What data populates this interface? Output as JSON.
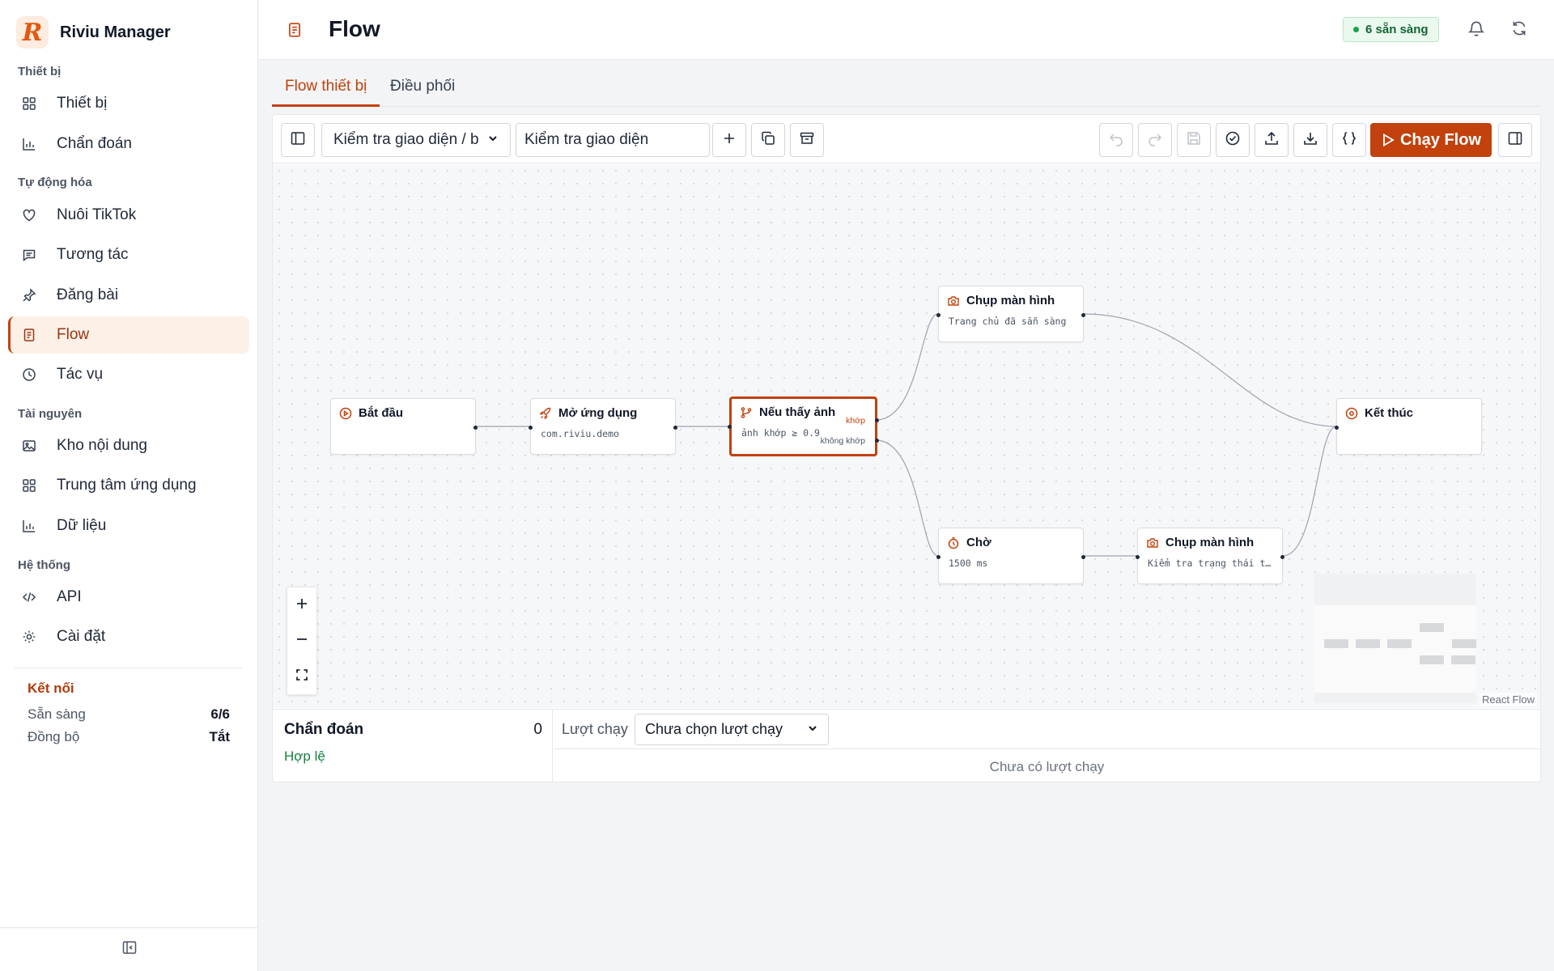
{
  "brand": {
    "logo_letter": "R",
    "name": "Riviu Manager"
  },
  "sidebar": {
    "sections": [
      {
        "label": "Thiết bị"
      },
      {
        "label": "Tự động hóa"
      },
      {
        "label": "Tài nguyên"
      },
      {
        "label": "Hệ thống"
      }
    ],
    "items": [
      {
        "label": "Thiết bị",
        "icon": "grid-icon"
      },
      {
        "label": "Chẩn đoán",
        "icon": "bar-chart-icon"
      },
      {
        "label": "Nuôi TikTok",
        "icon": "heart-icon"
      },
      {
        "label": "Tương tác",
        "icon": "message-icon"
      },
      {
        "label": "Đăng bài",
        "icon": "pin-icon"
      },
      {
        "label": "Flow",
        "icon": "document-icon",
        "active": true
      },
      {
        "label": "Tác vụ",
        "icon": "clock-icon"
      },
      {
        "label": "Kho nội dung",
        "icon": "image-icon"
      },
      {
        "label": "Trung tâm ứng dụng",
        "icon": "apps-grid-icon"
      },
      {
        "label": "Dữ liệu",
        "icon": "bar-chart-icon"
      },
      {
        "label": "API",
        "icon": "code-icon"
      },
      {
        "label": "Cài đặt",
        "icon": "sun-gear-icon"
      }
    ],
    "connection": {
      "title": "Kết nối",
      "rows": [
        {
          "key": "Sẵn sàng",
          "value": "6/6"
        },
        {
          "key": "Đồng bộ",
          "value": "Tắt"
        }
      ]
    }
  },
  "header": {
    "title": "Flow",
    "ready_badge": "6 sẵn sàng"
  },
  "tabs": [
    {
      "label": "Flow thiết bị",
      "active": true
    },
    {
      "label": "Điều phối",
      "active": false
    }
  ],
  "toolbar": {
    "flow_select": "Kiểm tra giao diện / b",
    "flow_name": "Kiểm tra giao diện",
    "run_label": "Chạy Flow"
  },
  "nodes": {
    "start": {
      "title": "Bắt đầu",
      "sub": ""
    },
    "open_app": {
      "title": "Mở ứng dụng",
      "sub": "com.riviu.demo"
    },
    "if_image": {
      "title": "Nếu thấy ảnh",
      "sub": "ảnh khớp ≥ 0.9",
      "branch_true": "khớp",
      "branch_false": "không khớp"
    },
    "screenshot_1": {
      "title": "Chụp màn hình",
      "sub": "Trang chủ đã sẵn sàng"
    },
    "end": {
      "title": "Kết thúc",
      "sub": ""
    },
    "wait": {
      "title": "Chờ",
      "sub": "1500 ms"
    },
    "screenshot_2": {
      "title": "Chụp màn hình",
      "sub": "Kiểm tra trạng thái t…"
    }
  },
  "canvas": {
    "attribution": "React Flow"
  },
  "diagnostics": {
    "title": "Chẩn đoán",
    "count": "0",
    "status": "Hợp lệ"
  },
  "runs": {
    "label": "Lượt chạy",
    "select": "Chưa chọn lượt chạy",
    "empty": "Chưa có lượt chạy"
  },
  "colors": {
    "accent": "#c2410c",
    "success": "#15803d",
    "badge_bg": "#eaf8ee"
  }
}
